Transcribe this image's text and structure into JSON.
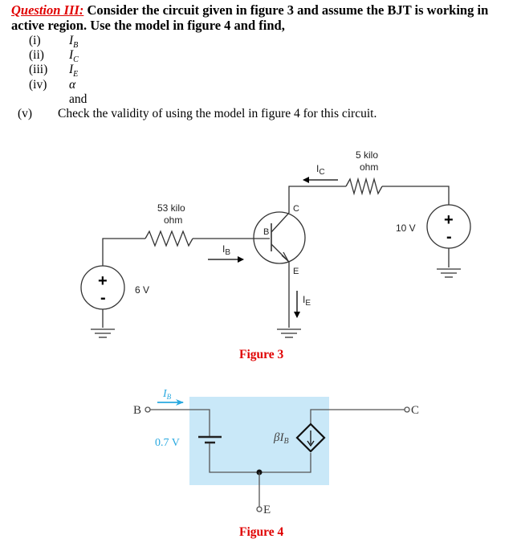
{
  "question": {
    "label": "Question III:",
    "text": " Consider the circuit given in figure 3 and assume the BJT is working in active region. Use the model in figure 4 and find,",
    "items": [
      {
        "num": "(i)",
        "symbol": "I",
        "sub": "B"
      },
      {
        "num": "(ii)",
        "symbol": "I",
        "sub": "C"
      },
      {
        "num": "(iii)",
        "symbol": "I",
        "sub": "E"
      },
      {
        "num": "(iv)",
        "symbol": "α",
        "sub": ""
      },
      {
        "num": "",
        "symbol": "",
        "sub": "",
        "text": "and"
      },
      {
        "num": "(v)",
        "symbol": "",
        "sub": "",
        "text": "Check the validity of using the model in figure 4 for this circuit."
      }
    ]
  },
  "figure3": {
    "caption": "Figure 3",
    "base_source": {
      "label": "6 V",
      "plus": "+",
      "minus": "-"
    },
    "base_resistor": {
      "line1": "53 kilo",
      "line2": "ohm"
    },
    "collector_resistor": {
      "line1": "5 kilo",
      "line2": "ohm"
    },
    "collector_source": {
      "label": "10 V",
      "plus": "+",
      "minus": "-"
    },
    "transistor": {
      "base": "B",
      "collector": "C",
      "emitter": "E"
    },
    "currents": {
      "ib": "I",
      "ib_sub": "B",
      "ic": "I",
      "ic_sub": "C",
      "ie": "I",
      "ie_sub": "E"
    }
  },
  "figure4": {
    "caption": "Figure 4",
    "terminal_b": "B",
    "terminal_c": "C",
    "terminal_e": "E",
    "current": "I",
    "current_sub": "B",
    "battery_label": "0.7 V",
    "dependent_source": "βI",
    "dependent_source_sub": "B",
    "box_color": "#c9e8f8",
    "accent_color": "#29a9e0"
  }
}
